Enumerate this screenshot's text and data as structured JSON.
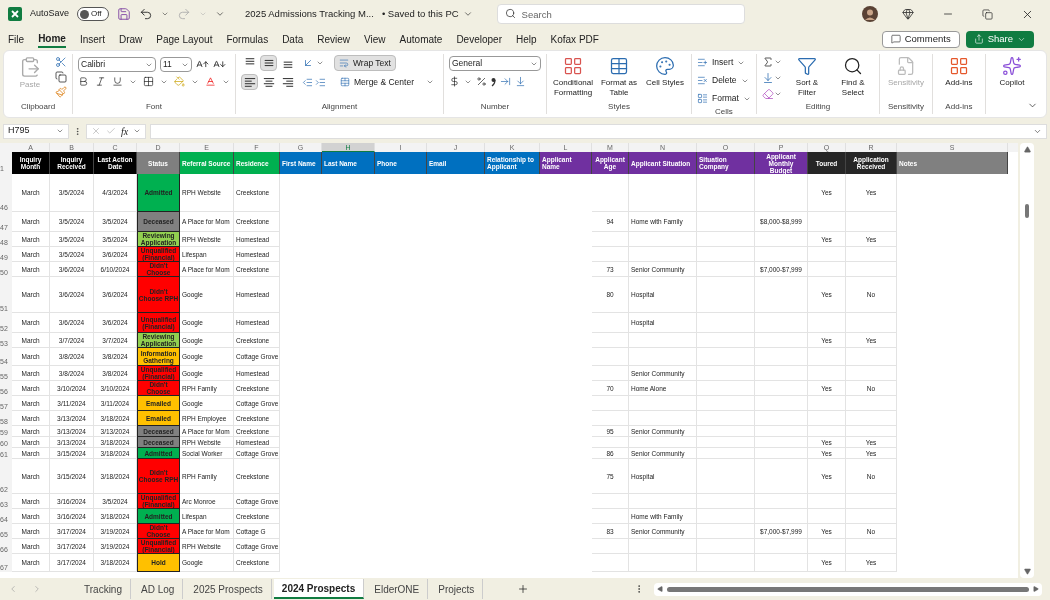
{
  "title_bar": {
    "autosave_label": "AutoSave",
    "autosave": {
      "label": "Off",
      "on": false
    },
    "title": "2025 Admissions Tracking M...",
    "save_status": "• Saved to this PC",
    "search": {
      "placeholder": "Search"
    }
  },
  "menu_tabs": [
    {
      "label": "File",
      "selected": false
    },
    {
      "label": "Home",
      "selected": true
    },
    {
      "label": "Insert",
      "selected": false
    },
    {
      "label": "Draw",
      "selected": false
    },
    {
      "label": "Page Layout",
      "selected": false
    },
    {
      "label": "Formulas",
      "selected": false
    },
    {
      "label": "Data",
      "selected": false
    },
    {
      "label": "Review",
      "selected": false
    },
    {
      "label": "View",
      "selected": false
    },
    {
      "label": "Automate",
      "selected": false
    },
    {
      "label": "Developer",
      "selected": false
    },
    {
      "label": "Help",
      "selected": false
    },
    {
      "label": "Kofax PDF",
      "selected": false
    }
  ],
  "actions": {
    "comments": "Comments",
    "share": "Share"
  },
  "ribbon": {
    "clipboard": {
      "label": "Clipboard",
      "paste": {
        "label": "Paste",
        "disabled": true
      }
    },
    "font": {
      "label": "Font",
      "family": "Calibri",
      "size": "11"
    },
    "alignment": {
      "label": "Alignment",
      "vertical_align": [
        {
          "kind": "top",
          "selected": false
        },
        {
          "kind": "middle",
          "selected": true
        },
        {
          "kind": "bottom",
          "selected": false
        }
      ],
      "horizontal_align": [
        {
          "kind": "left",
          "selected": true
        },
        {
          "kind": "center",
          "selected": false
        },
        {
          "kind": "right",
          "selected": false
        }
      ],
      "wrap_text": {
        "label": "Wrap Text",
        "selected": true
      },
      "merge": "Merge & Center"
    },
    "number": {
      "label": "Number",
      "format": "General"
    },
    "styles": {
      "label": "Styles",
      "buttons": [
        "Conditional Formatting",
        "Format as Table",
        "Cell Styles"
      ]
    },
    "cells": {
      "label": "Cells",
      "buttons": [
        "Insert",
        "Delete",
        "Format"
      ]
    },
    "editing": {
      "label": "Editing",
      "buttons": [
        "Sort & Filter",
        "Find & Select"
      ]
    },
    "sensitivity": {
      "label": "Sensitivity",
      "button": "Sensitivity",
      "disabled": true
    },
    "addins": {
      "label": "Add-ins",
      "button": "Add-ins"
    },
    "copilot": {
      "button": "Copilot"
    }
  },
  "formula_bar": {
    "name_box": "H795",
    "function_label": "fx"
  },
  "sheet": {
    "columns": [
      {
        "letter": "A",
        "header": "Inquiry Month",
        "color": "#000000",
        "selected": false
      },
      {
        "letter": "B",
        "header": "Inquiry Received",
        "color": "#000000",
        "selected": false
      },
      {
        "letter": "C",
        "header": "Last Action Date",
        "color": "#000000",
        "selected": false
      },
      {
        "letter": "D",
        "header": "Status",
        "color": "#7f7f7f",
        "selected": false
      },
      {
        "letter": "E",
        "header": "Referral Source",
        "color": "#00b050",
        "selected": false
      },
      {
        "letter": "F",
        "header": "Residence",
        "color": "#00b050",
        "selected": false
      },
      {
        "letter": "G",
        "header": "First Name",
        "color": "#0070c0",
        "selected": false
      },
      {
        "letter": "H",
        "header": "Last Name",
        "color": "#0070c0",
        "selected": true
      },
      {
        "letter": "I",
        "header": "Phone",
        "color": "#0070c0",
        "selected": false
      },
      {
        "letter": "J",
        "header": "Email",
        "color": "#0070c0",
        "selected": false
      },
      {
        "letter": "K",
        "header": "Relationship to Applicant",
        "color": "#0070c0",
        "selected": false
      },
      {
        "letter": "L",
        "header": "Applicant Name",
        "color": "#7030a0",
        "selected": false
      },
      {
        "letter": "M",
        "header": "Applicant Age",
        "color": "#7030a0",
        "selected": false
      },
      {
        "letter": "N",
        "header": "Applicant Situation",
        "color": "#7030a0",
        "selected": false
      },
      {
        "letter": "O",
        "header": "Situation Company",
        "color": "#7030a0",
        "selected": false
      },
      {
        "letter": "P",
        "header": "Applicant Monthly Budget",
        "color": "#7030a0",
        "selected": false
      },
      {
        "letter": "Q",
        "header": "Toured",
        "color": "#262626",
        "selected": false
      },
      {
        "letter": "R",
        "header": "Application Received",
        "color": "#262626",
        "selected": false
      },
      {
        "letter": "S",
        "header": "Notes",
        "color": "#808080",
        "selected": false
      }
    ],
    "header_row": "1",
    "rows": [
      {
        "number": "46",
        "month": "March",
        "received": "3/5/2024",
        "last_action": "4/3/2024",
        "status": {
          "label": "Admitted",
          "color": "#00b050"
        },
        "referral": "RPH Website",
        "residence": "Creekstone",
        "toured": "Yes",
        "app_received": "Yes"
      },
      {
        "number": "47",
        "month": "March",
        "received": "3/5/2024",
        "last_action": "3/5/2024",
        "status": {
          "label": "Deceased",
          "color": "#808080"
        },
        "referral": "A Place for Mom",
        "residence": "Creekstone",
        "age": "94",
        "situation": "Home with Family",
        "budget": "$8,000-$8,999"
      },
      {
        "number": "48",
        "month": "March",
        "received": "3/5/2024",
        "last_action": "3/5/2024",
        "status": {
          "label": "Reviewing Application",
          "color": "#92d050"
        },
        "referral": "RPH Website",
        "residence": "Homestead",
        "toured": "Yes",
        "app_received": "Yes"
      },
      {
        "number": "49",
        "month": "March",
        "received": "3/5/2024",
        "last_action": "3/6/2024",
        "status": {
          "label": "Unqualified (Financial)",
          "color": "#ff0000"
        },
        "referral": "Lifespan",
        "residence": "Homestead"
      },
      {
        "number": "50",
        "month": "March",
        "received": "3/6/2024",
        "last_action": "6/10/2024",
        "status": {
          "label": "Didn't Choose",
          "color": "#ff0000"
        },
        "referral": "A Place for Mom",
        "residence": "Creekstone",
        "age": "73",
        "situation": "Senior Community",
        "budget": "$7,000-$7,999"
      },
      {
        "number": "51",
        "month": "March",
        "received": "3/6/2024",
        "last_action": "3/6/2024",
        "status": {
          "label": "Didn't Choose RPH",
          "color": "#ff0000"
        },
        "referral": "Google",
        "residence": "Homestead",
        "age": "80",
        "situation": "Hospital",
        "toured": "Yes",
        "app_received": "No"
      },
      {
        "number": "52",
        "month": "March",
        "received": "3/6/2024",
        "last_action": "3/6/2024",
        "status": {
          "label": "Unqualified (Financial)",
          "color": "#ff0000"
        },
        "referral": "Google",
        "residence": "Homestead",
        "situation": "Hospital"
      },
      {
        "number": "53",
        "month": "March",
        "received": "3/7/2024",
        "last_action": "3/7/2024",
        "status": {
          "label": "Reviewing Application",
          "color": "#92d050"
        },
        "referral": "Google",
        "residence": "Creekstone",
        "toured": "Yes",
        "app_received": "Yes"
      },
      {
        "number": "54",
        "month": "March",
        "received": "3/8/2024",
        "last_action": "3/8/2024",
        "status": {
          "label": "Information Gathering",
          "color": "#ffc000"
        },
        "referral": "Google",
        "residence": "Cottage Grove"
      },
      {
        "number": "55",
        "month": "March",
        "received": "3/8/2024",
        "last_action": "3/8/2024",
        "status": {
          "label": "Unqualified (Financial)",
          "color": "#ff0000"
        },
        "referral": "Google",
        "residence": "Homestead",
        "situation": "Senior Community"
      },
      {
        "number": "56",
        "month": "March",
        "received": "3/10/2024",
        "last_action": "3/10/2024",
        "status": {
          "label": "Didn't Choose",
          "color": "#ff0000"
        },
        "referral": "RPH Family",
        "residence": "Creekstone",
        "age": "70",
        "situation": "Home Alone",
        "toured": "Yes",
        "app_received": "No"
      },
      {
        "number": "57",
        "month": "March",
        "received": "3/11/2024",
        "last_action": "3/11/2024",
        "status": {
          "label": "Emailed",
          "color": "#ffc000"
        },
        "referral": "Google",
        "residence": "Cottage Grove"
      },
      {
        "number": "58",
        "month": "March",
        "received": "3/13/2024",
        "last_action": "3/18/2024",
        "status": {
          "label": "Emailed",
          "color": "#ffc000"
        },
        "referral": "RPH Employee",
        "residence": "Creekstone"
      },
      {
        "number": "59",
        "month": "March",
        "received": "3/13/2024",
        "last_action": "3/13/2024",
        "status": {
          "label": "Deceased",
          "color": "#808080"
        },
        "referral": "A Place for Mom",
        "residence": "Creekstone",
        "age": "95",
        "situation": "Senior Community"
      },
      {
        "number": "60",
        "month": "March",
        "received": "3/13/2024",
        "last_action": "3/18/2024",
        "status": {
          "label": "Deceased",
          "color": "#808080"
        },
        "referral": "RPH Website",
        "residence": "Homestead",
        "toured": "Yes",
        "app_received": "Yes"
      },
      {
        "number": "61",
        "month": "March",
        "received": "3/15/2024",
        "last_action": "3/18/2024",
        "status": {
          "label": "Admitted",
          "color": "#00b050"
        },
        "referral": "Social Worker",
        "residence": "Cottage Grove",
        "age": "86",
        "situation": "Senior Community",
        "toured": "Yes",
        "app_received": "Yes"
      },
      {
        "number": "62",
        "month": "March",
        "received": "3/15/2024",
        "last_action": "3/18/2024",
        "status": {
          "label": "Didn't Choose RPH",
          "color": "#ff0000"
        },
        "referral": "RPH Family",
        "residence": "Creekstone",
        "age": "75",
        "situation": "Hospital",
        "toured": "Yes",
        "app_received": "No"
      },
      {
        "number": "63",
        "month": "March",
        "received": "3/16/2024",
        "last_action": "3/5/2024",
        "status": {
          "label": "Unqualified (Financial)",
          "color": "#ff0000"
        },
        "referral": "Arc Monroe",
        "residence": "Cottage Grove"
      },
      {
        "number": "64",
        "month": "March",
        "received": "3/16/2024",
        "last_action": "3/18/2024",
        "status": {
          "label": "Admitted",
          "color": "#00b050"
        },
        "referral": "Lifespan",
        "residence": "Creekstone",
        "situation": "Home with Family"
      },
      {
        "number": "65",
        "month": "March",
        "received": "3/17/2024",
        "last_action": "3/19/2024",
        "status": {
          "label": "Didn't Choose",
          "color": "#ff0000"
        },
        "referral": "A Place for Mom",
        "residence": "Cottage G",
        "age": "83",
        "situation": "Senior Community",
        "budget": "$7,000-$7,999",
        "toured": "Yes",
        "app_received": "No"
      },
      {
        "number": "66",
        "month": "March",
        "received": "3/17/2024",
        "last_action": "3/19/2024",
        "status": {
          "label": "Unqualified (Financial)",
          "color": "#ff0000"
        },
        "referral": "RPH Website",
        "residence": "Cottage Grove"
      },
      {
        "number": "67",
        "month": "March",
        "received": "3/17/2024",
        "last_action": "3/18/2024",
        "status": {
          "label": "Hold",
          "color": "#ffc000"
        },
        "referral": "Google",
        "residence": "Creekstone",
        "toured": "Yes",
        "app_received": "Yes"
      }
    ]
  },
  "sheet_tabs": [
    {
      "label": "Tracking",
      "selected": false
    },
    {
      "label": "AD Log",
      "selected": false
    },
    {
      "label": "2025 Prospects",
      "selected": false
    },
    {
      "label": "2024 Prospects",
      "selected": true
    },
    {
      "label": "ElderONE",
      "selected": false
    },
    {
      "label": "Projects",
      "selected": false
    }
  ]
}
